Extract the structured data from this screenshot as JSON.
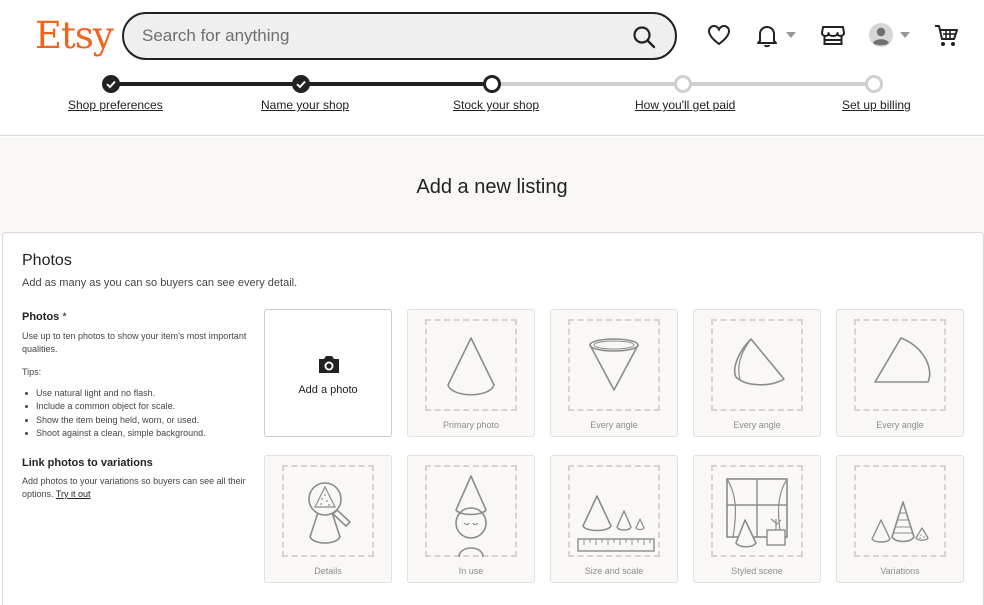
{
  "header": {
    "logo": "Etsy",
    "search_placeholder": "Search for anything"
  },
  "steps": [
    {
      "label": "Shop preferences",
      "state": "done"
    },
    {
      "label": "Name your shop",
      "state": "done"
    },
    {
      "label": "Stock your shop",
      "state": "current"
    },
    {
      "label": "How you'll get paid",
      "state": "todo"
    },
    {
      "label": "Set up billing",
      "state": "todo"
    }
  ],
  "page": {
    "title": "Add a new listing"
  },
  "photos_section": {
    "title": "Photos",
    "subtitle": "Add as many as you can so buyers can see every detail.",
    "photos_heading": "Photos",
    "required_mark": "*",
    "photos_desc": "Use up to ten photos to show your item's most important qualities.",
    "tips_label": "Tips:",
    "tips": [
      "Use natural light and no flash.",
      "Include a common object for scale.",
      "Show the item being held, worn, or used.",
      "Shoot against a clean, simple background."
    ],
    "variations_heading": "Link photos to variations",
    "variations_desc": "Add photos to your variations so buyers can see all their options.",
    "try_it_out": "Try it out",
    "add_photo_label": "Add a photo",
    "tiles": [
      "Primary photo",
      "Every angle",
      "Every angle",
      "Every angle",
      "Details",
      "In use",
      "Size and scale",
      "Styled scene",
      "Variations"
    ]
  },
  "colors": {
    "brand": "#f1641e",
    "text": "#222222",
    "muted_bg": "#f9f8f4"
  }
}
